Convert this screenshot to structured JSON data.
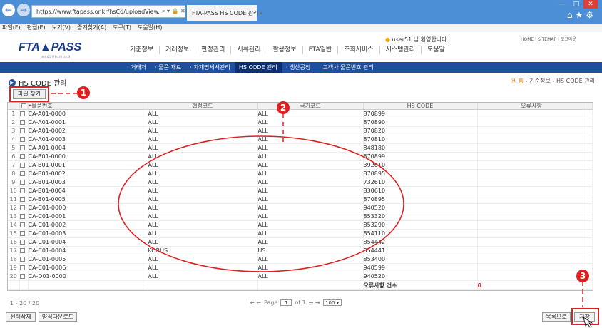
{
  "browser": {
    "url": "https://www.ftapass.or.kr/hsCd/uploadView.",
    "url_controls": "⌕ ▾ 🔒 ✕ C",
    "tab_title": "FTA-PASS HS CODE 관리",
    "tab_close": "×",
    "menu": [
      "파일(F)",
      "편집(E)",
      "보기(V)",
      "즐겨찾기(A)",
      "도구(T)",
      "도움말(H)"
    ]
  },
  "site": {
    "logo": "FTA▲PASS",
    "logo_sub": "초개호류전통지원시스템",
    "welcome": "user51 님 환영합니다.",
    "top_links": "HOME  |  SITEMAP  |  로그아웃",
    "main_menu": [
      "기준정보",
      "거래정보",
      "판정관리",
      "서류관리",
      "활용정보",
      "FTA일반",
      "조회서비스",
      "시스템관리",
      "도움말"
    ],
    "sub_menu": [
      "· 거래처",
      "· 물품·재료",
      "· 자재명세서관리",
      "HS CODE 관리",
      "· 생산공정",
      "· 고객사 물품번호 관리"
    ]
  },
  "page": {
    "title": "HS CODE 관리",
    "breadcrumb_home": "Ⓗ 홈",
    "breadcrumb_rest": " › 기준정보 › HS CODE 관리",
    "file_button": "파일 찾기"
  },
  "table": {
    "headers": [
      "물품번호",
      "협정코드",
      "국가코드",
      "HS CODE",
      "오류사항"
    ],
    "rows": [
      [
        "CA-A01-0000",
        "ALL",
        "ALL",
        "870899",
        ""
      ],
      [
        "CA-A01-0001",
        "ALL",
        "ALL",
        "870890",
        ""
      ],
      [
        "CA-A01-0002",
        "ALL",
        "ALL",
        "870820",
        ""
      ],
      [
        "CA-A01-0003",
        "ALL",
        "ALL",
        "870810",
        ""
      ],
      [
        "CA-A01-0004",
        "ALL",
        "ALL",
        "848180",
        ""
      ],
      [
        "CA-B01-0000",
        "ALL",
        "ALL",
        "870899",
        ""
      ],
      [
        "CA-B01-0001",
        "ALL",
        "ALL",
        "392610",
        ""
      ],
      [
        "CA-B01-0002",
        "ALL",
        "ALL",
        "870895",
        ""
      ],
      [
        "CA-B01-0003",
        "ALL",
        "ALL",
        "732610",
        ""
      ],
      [
        "CA-B01-0004",
        "ALL",
        "ALL",
        "830610",
        ""
      ],
      [
        "CA-B01-0005",
        "ALL",
        "ALL",
        "870895",
        ""
      ],
      [
        "CA-C01-0000",
        "ALL",
        "ALL",
        "940520",
        ""
      ],
      [
        "CA-C01-0001",
        "ALL",
        "ALL",
        "853320",
        ""
      ],
      [
        "CA-C01-0002",
        "ALL",
        "ALL",
        "853290",
        ""
      ],
      [
        "CA-C01-0003",
        "ALL",
        "ALL",
        "854110",
        ""
      ],
      [
        "CA-C01-0004",
        "ALL",
        "ALL",
        "854442",
        ""
      ],
      [
        "CA-C01-0004",
        "KORUS",
        "US",
        "854441",
        ""
      ],
      [
        "CA-C01-0005",
        "ALL",
        "ALL",
        "853400",
        ""
      ],
      [
        "CA-C01-0006",
        "ALL",
        "ALL",
        "940599",
        ""
      ],
      [
        "CA-D01-0000",
        "ALL",
        "ALL",
        "940520",
        ""
      ]
    ],
    "error_count_label": "오류사항 건수",
    "error_count": "0"
  },
  "pager": {
    "count": "1 - 20 / 20",
    "first_prev": "⇤ ←",
    "page_label": "Page",
    "page_value": "1",
    "of_label": "of 1",
    "next_last": "→ ⇥",
    "page_size": "100 ▾"
  },
  "buttons": {
    "delete_selected": "선택삭제",
    "download_template": "양식다운로드",
    "to_list": "목록으로",
    "save": "저장"
  },
  "annotations": [
    "1",
    "2",
    "3"
  ],
  "colors": {
    "annotation": "#e02020",
    "nav_blue": "#1f4e9c",
    "titlebar": "#4d8fd6"
  }
}
